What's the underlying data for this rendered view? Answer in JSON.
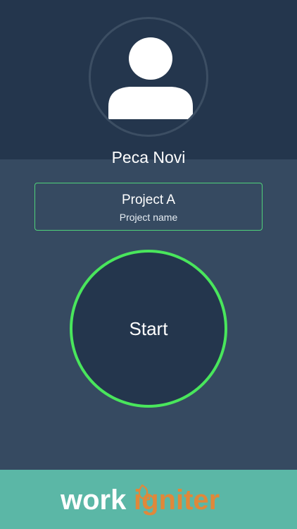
{
  "profile": {
    "avatar_icon": "user-silhouette-icon",
    "name": "Peca Novi"
  },
  "project": {
    "title": "Project A",
    "subtitle": "Project name"
  },
  "start_button": {
    "label": "Start"
  },
  "footer": {
    "logo_part1": "work",
    "logo_part2": "igniter"
  },
  "colors": {
    "header_bg": "#24364d",
    "body_bg": "#364a61",
    "accent_green": "#49e65c",
    "footer_bg": "#5bb7a6",
    "logo_orange": "#e0883a"
  }
}
